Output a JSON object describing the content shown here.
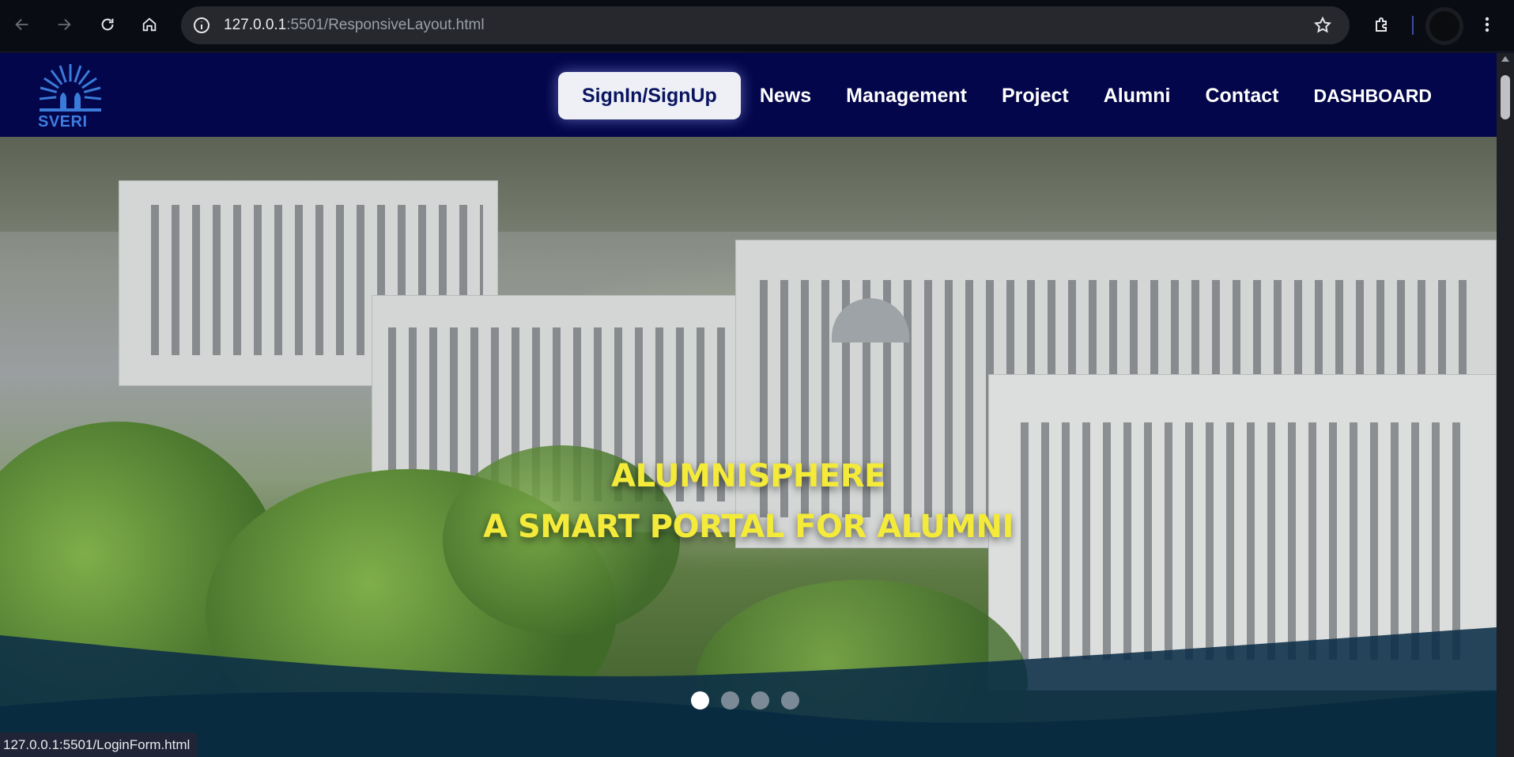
{
  "browser": {
    "url_host": "127.0.0.1",
    "url_rest": ":5501/ResponsiveLayout.html",
    "status_url": "127.0.0.1:5501/LoginForm.html",
    "icons": [
      "back-icon",
      "forward-icon",
      "reload-icon",
      "home-icon",
      "info-icon",
      "star-icon",
      "extensions-icon",
      "profile-avatar",
      "more-icon"
    ]
  },
  "site": {
    "logo_text": "SVERI",
    "nav": {
      "signin": "SignIn/SignUp",
      "news": "News",
      "management": "Management",
      "project": "Project",
      "alumni": "Alumni",
      "contact": "Contact",
      "dashboard": "DASHBOARD"
    },
    "hero": {
      "line1": "ALUMNISPHERE",
      "line2": "A SMART PORTAL FOR ALUMNI",
      "slide_count": 4,
      "active_slide": 1
    }
  },
  "colors": {
    "header_bg": "#03064a",
    "hero_title": "#f3ea3a",
    "wave": "#0b2e47"
  }
}
